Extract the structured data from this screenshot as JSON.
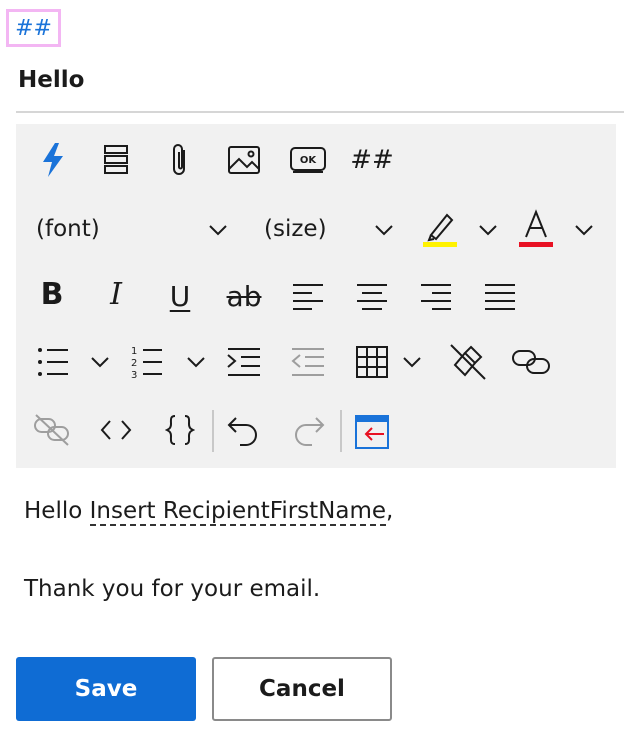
{
  "badge": {
    "text": "##"
  },
  "subject": {
    "value": "Hello"
  },
  "toolbar": {
    "row1": {
      "quick_icon": "lightning-icon",
      "hash_label": "##"
    },
    "font_dropdown": "(font)",
    "size_dropdown": "(size)",
    "highlight_color": "#fff200",
    "font_color": "#e81123",
    "bold_label": "B",
    "italic_label": "I",
    "underline_label": "U",
    "strike_label": "ab",
    "button_text": "OK",
    "accent": "#1a73d9"
  },
  "editor": {
    "line1_prefix": "Hello ",
    "line1_token": "Insert RecipientFirstName",
    "line1_suffix": ",",
    "line2": "Thank you for your email."
  },
  "actions": {
    "save_label": "Save",
    "cancel_label": "Cancel"
  }
}
